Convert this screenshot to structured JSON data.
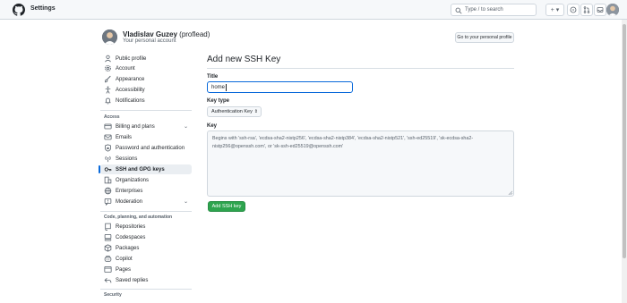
{
  "topbar": {
    "title": "Settings",
    "search_placeholder": "Type / to search",
    "new_label": "+ ▾"
  },
  "header": {
    "display_name": "Vladislav Guzey",
    "handle": "(proflead)",
    "subtitle": "Your personal account",
    "profile_button": "Go to your personal profile"
  },
  "sidebar": {
    "items": [
      {
        "label": "Public profile",
        "icon": "person-icon"
      },
      {
        "label": "Account",
        "icon": "gear-icon"
      },
      {
        "label": "Appearance",
        "icon": "paintbrush-icon"
      },
      {
        "label": "Accessibility",
        "icon": "accessibility-icon"
      },
      {
        "label": "Notifications",
        "icon": "bell-icon"
      }
    ],
    "access_title": "Access",
    "access_items": [
      {
        "label": "Billing and plans",
        "icon": "credit-card-icon",
        "expandable": true
      },
      {
        "label": "Emails",
        "icon": "mail-icon"
      },
      {
        "label": "Password and authentication",
        "icon": "shield-lock-icon"
      },
      {
        "label": "Sessions",
        "icon": "broadcast-icon"
      },
      {
        "label": "SSH and GPG keys",
        "icon": "key-icon",
        "active": true
      },
      {
        "label": "Organizations",
        "icon": "organization-icon"
      },
      {
        "label": "Enterprises",
        "icon": "globe-icon"
      },
      {
        "label": "Moderation",
        "icon": "report-icon",
        "expandable": true
      }
    ],
    "code_title": "Code, planning, and automation",
    "code_items": [
      {
        "label": "Repositories",
        "icon": "repo-icon"
      },
      {
        "label": "Codespaces",
        "icon": "codespaces-icon"
      },
      {
        "label": "Packages",
        "icon": "package-icon"
      },
      {
        "label": "Copilot",
        "icon": "copilot-icon"
      },
      {
        "label": "Pages",
        "icon": "browser-icon"
      },
      {
        "label": "Saved replies",
        "icon": "reply-icon"
      }
    ],
    "security_title": "Security"
  },
  "main": {
    "title": "Add new SSH Key",
    "title_label": "Title",
    "title_value": "home",
    "key_type_label": "Key type",
    "key_type_value": "Authentication Key",
    "key_label": "Key",
    "key_placeholder": "Begins with 'ssh-rsa', 'ecdsa-sha2-nistp256', 'ecdsa-sha2-nistp384', 'ecdsa-sha2-nistp521', 'ssh-ed25519', 'sk-ecdsa-sha2-nistp256@openssh.com', or 'sk-ssh-ed25519@openssh.com'",
    "submit_label": "Add SSH key"
  },
  "colors": {
    "accent": "#0969da",
    "primary_button": "#2da44e"
  }
}
